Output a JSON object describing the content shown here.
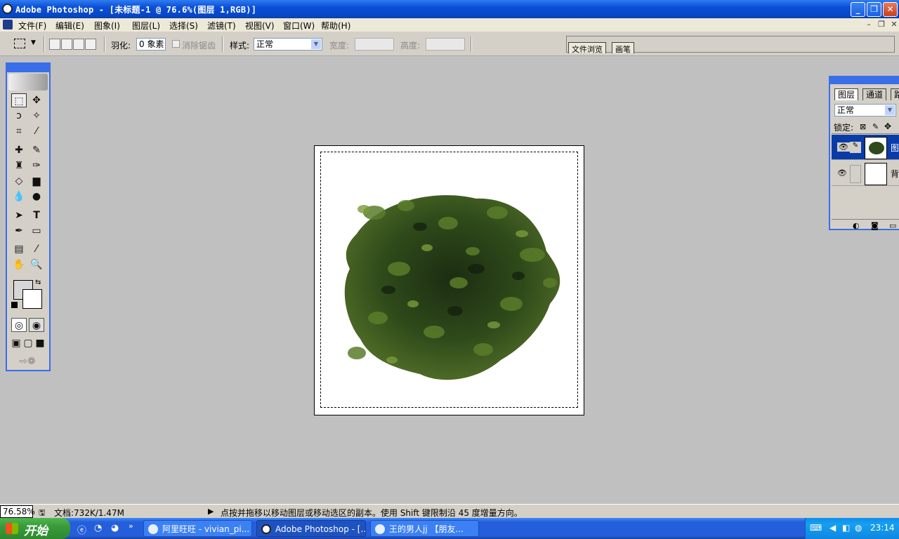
{
  "window": {
    "title": "Adobe Photoshop - [未标题-1 @ 76.6%(图层 1,RGB)]"
  },
  "menu": [
    "文件(F)",
    "编辑(E)",
    "图象(I)",
    "图层(L)",
    "选择(S)",
    "滤镜(T)",
    "视图(V)",
    "窗口(W)",
    "帮助(H)"
  ],
  "options": {
    "feather_label": "羽化:",
    "feather_value": "0 象素",
    "antialias_label": "消除锯齿",
    "style_label": "样式:",
    "style_value": "正常",
    "width_label": "宽度:",
    "height_label": "高度:"
  },
  "palette_well": {
    "tabs": [
      "文件浏览",
      "画笔"
    ]
  },
  "layers_palette": {
    "tabs": [
      "图层",
      "通道",
      "路"
    ],
    "blend_mode": "正常",
    "lock_label": "锁定:",
    "layers": [
      {
        "name": "图",
        "selected": true
      },
      {
        "name": "背",
        "selected": false
      }
    ]
  },
  "status": {
    "zoom": "76.58%",
    "doc": "文档:732K/1.47M",
    "hint": "点按并拖移以移动图层或移动选区的副本。使用 Shift 键限制沿 45 度增量方向。"
  },
  "taskbar": {
    "start": "开始",
    "tasks": [
      {
        "label": "阿里旺旺 - vivian_pi...",
        "active": false
      },
      {
        "label": "Adobe Photoshop - [...",
        "active": true
      },
      {
        "label": "王的男人jj 【朋友...",
        "active": false
      }
    ],
    "clock": "23:14"
  },
  "colors": {
    "accent": "#0a4fd6",
    "canvas_bg": "#c0c0c0",
    "tea": "#2f4a1a"
  }
}
